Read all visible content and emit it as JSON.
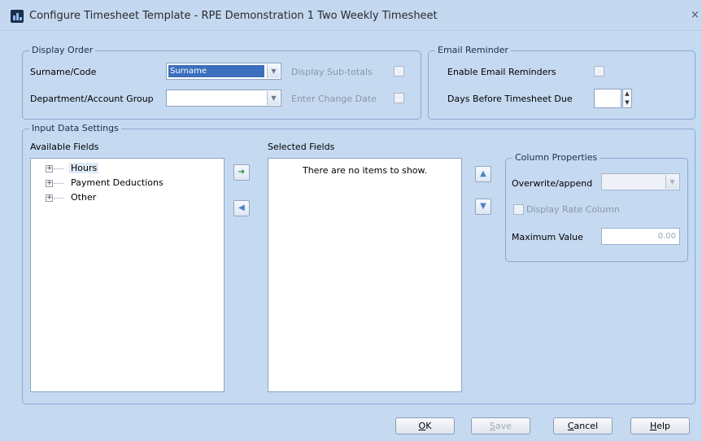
{
  "window": {
    "title": "Configure Timesheet Template - RPE Demonstration 1 Two Weekly Timesheet",
    "close_glyph": "×"
  },
  "display_order": {
    "legend": "Display Order",
    "surname_label": "Surname/Code",
    "surname_value": "Surname",
    "display_subtotals_label": "Display Sub-totals",
    "department_label": "Department/Account Group",
    "department_value": "",
    "enter_change_date_label": "Enter Change Date"
  },
  "email_reminder": {
    "legend": "Email Reminder",
    "enable_label": "Enable Email Reminders",
    "days_label": "Days Before Timesheet Due",
    "days_value": ""
  },
  "input_data": {
    "legend": "Input Data Settings",
    "available_label": "Available Fields",
    "available_items": [
      "Hours",
      "Payment Deductions",
      "Other"
    ],
    "selected_label": "Selected Fields",
    "empty_message": "There are no items to show."
  },
  "column_properties": {
    "legend": "Column Properties",
    "overwrite_label": "Overwrite/append",
    "overwrite_value": "",
    "display_rate_label": "Display Rate Column",
    "max_value_label": "Maximum Value",
    "max_value": "0.00"
  },
  "buttons": {
    "ok_first": "O",
    "ok_rest": "K",
    "save_first": "S",
    "save_rest": "ave",
    "cancel_first": "C",
    "cancel_rest": "ancel",
    "help_first": "H",
    "help_rest": "elp"
  },
  "icons": {
    "app": "app-logo-icon",
    "expand": "plus-expand-icon",
    "add": "arrow-right-icon",
    "remove": "arrow-left-icon",
    "up": "arrow-up-icon",
    "down": "arrow-down-icon",
    "dropdown": "chevron-down-icon"
  }
}
